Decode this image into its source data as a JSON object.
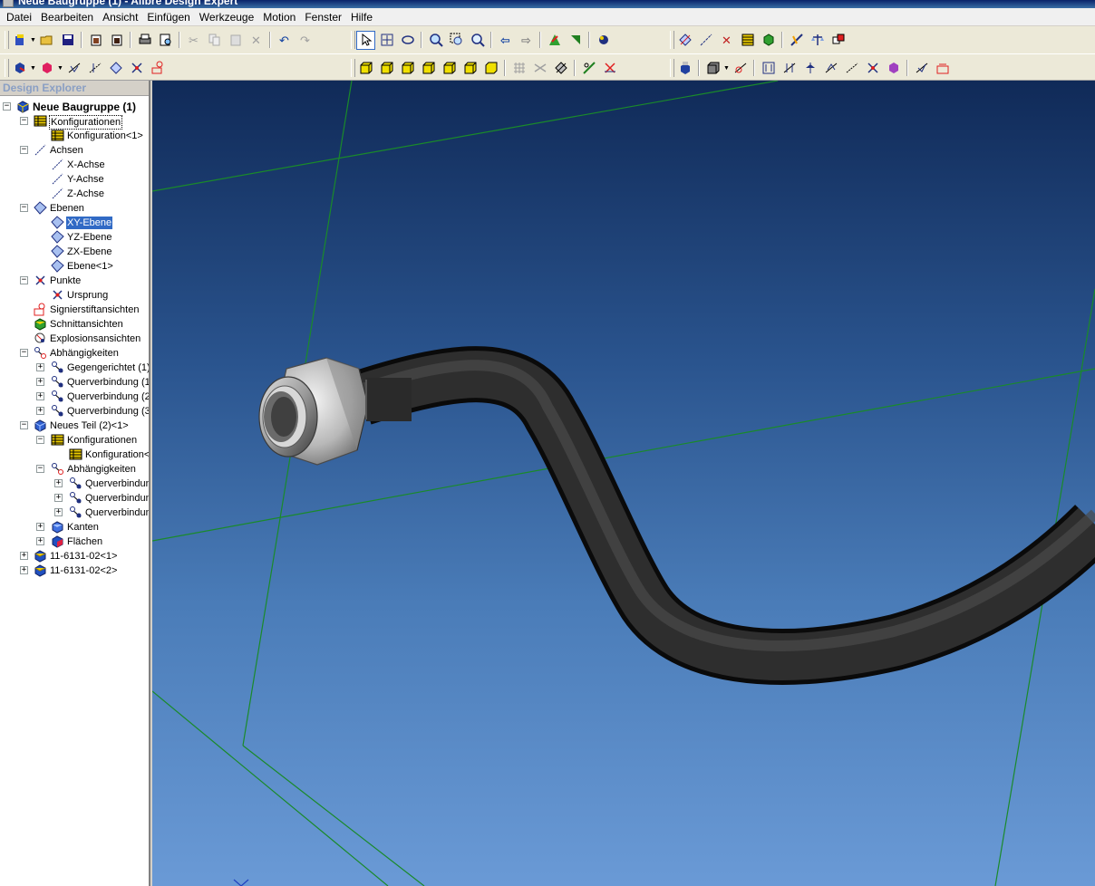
{
  "window": {
    "title": "Neue Baugruppe (1) - Alibre Design Expert"
  },
  "menu": [
    "Datei",
    "Bearbeiten",
    "Ansicht",
    "Einfügen",
    "Werkzeuge",
    "Motion",
    "Fenster",
    "Hilfe"
  ],
  "explorer": {
    "header": "Design Explorer",
    "nodes": [
      {
        "label": "Neue Baugruppe (1)",
        "level": 0,
        "toggle": "−",
        "icon": "assembly-icon",
        "bold": true
      },
      {
        "label": "Konfigurationen",
        "level": 1,
        "toggle": "−",
        "icon": "configurations-icon",
        "boxed": true
      },
      {
        "label": "Konfiguration<1>",
        "level": 2,
        "toggle": "",
        "icon": "configuration-icon"
      },
      {
        "label": "Achsen",
        "level": 1,
        "toggle": "−",
        "icon": "axes-icon"
      },
      {
        "label": "X-Achse",
        "level": 2,
        "toggle": "",
        "icon": "axis-icon"
      },
      {
        "label": "Y-Achse",
        "level": 2,
        "toggle": "",
        "icon": "axis-icon"
      },
      {
        "label": "Z-Achse",
        "level": 2,
        "toggle": "",
        "icon": "axis-icon"
      },
      {
        "label": "Ebenen",
        "level": 1,
        "toggle": "−",
        "icon": "planes-icon"
      },
      {
        "label": "XY-Ebene",
        "level": 2,
        "toggle": "",
        "icon": "plane-icon",
        "selected": true
      },
      {
        "label": "YZ-Ebene",
        "level": 2,
        "toggle": "",
        "icon": "plane-icon"
      },
      {
        "label": "ZX-Ebene",
        "level": 2,
        "toggle": "",
        "icon": "plane-icon"
      },
      {
        "label": "Ebene<1>",
        "level": 2,
        "toggle": "",
        "icon": "plane-icon"
      },
      {
        "label": "Punkte",
        "level": 1,
        "toggle": "−",
        "icon": "points-icon"
      },
      {
        "label": "Ursprung",
        "level": 2,
        "toggle": "",
        "icon": "point-icon"
      },
      {
        "label": "Signierstiftansichten",
        "level": 1,
        "toggle": "",
        "icon": "redline-icon"
      },
      {
        "label": "Schnittansichten",
        "level": 1,
        "toggle": "",
        "icon": "section-icon"
      },
      {
        "label": "Explosionsansichten",
        "level": 1,
        "toggle": "",
        "icon": "explode-icon"
      },
      {
        "label": "Abhängigkeiten",
        "level": 1,
        "toggle": "−",
        "icon": "constraints-icon"
      },
      {
        "label": "Gegengerichtet (1)",
        "level": 2,
        "toggle": "+",
        "icon": "constraint-icon"
      },
      {
        "label": "Querverbindung (1",
        "level": 2,
        "toggle": "+",
        "icon": "constraint-icon"
      },
      {
        "label": "Querverbindung (2",
        "level": 2,
        "toggle": "+",
        "icon": "constraint-icon"
      },
      {
        "label": "Querverbindung (3",
        "level": 2,
        "toggle": "+",
        "icon": "constraint-icon"
      },
      {
        "label": "Neues Teil (2)<1>",
        "level": 1,
        "toggle": "−",
        "icon": "part-icon"
      },
      {
        "label": "Konfigurationen",
        "level": 2,
        "toggle": "−",
        "icon": "configurations-icon"
      },
      {
        "label": "Konfiguration<",
        "level": 3,
        "toggle": "",
        "icon": "configuration-icon"
      },
      {
        "label": "Abhängigkeiten",
        "level": 2,
        "toggle": "−",
        "icon": "constraints-icon"
      },
      {
        "label": "Querverbindun",
        "level": 3,
        "toggle": "+",
        "icon": "constraint-icon"
      },
      {
        "label": "Querverbindun",
        "level": 3,
        "toggle": "+",
        "icon": "constraint-icon"
      },
      {
        "label": "Querverbindun",
        "level": 3,
        "toggle": "+",
        "icon": "constraint-icon"
      },
      {
        "label": "Kanten",
        "level": 2,
        "toggle": "+",
        "icon": "edges-icon"
      },
      {
        "label": "Flächen",
        "level": 2,
        "toggle": "+",
        "icon": "faces-icon"
      },
      {
        "label": "11-6131-02<1>",
        "level": 1,
        "toggle": "+",
        "icon": "subassembly-icon"
      },
      {
        "label": "11-6131-02<2>",
        "level": 1,
        "toggle": "+",
        "icon": "subassembly-icon"
      }
    ]
  },
  "colors": {
    "selection": "#316ac5",
    "plane_lines": "#1a8a2a",
    "hose": "#2a2a2a",
    "viewport_top": "#102a58",
    "viewport_bottom": "#6a9ad6"
  }
}
